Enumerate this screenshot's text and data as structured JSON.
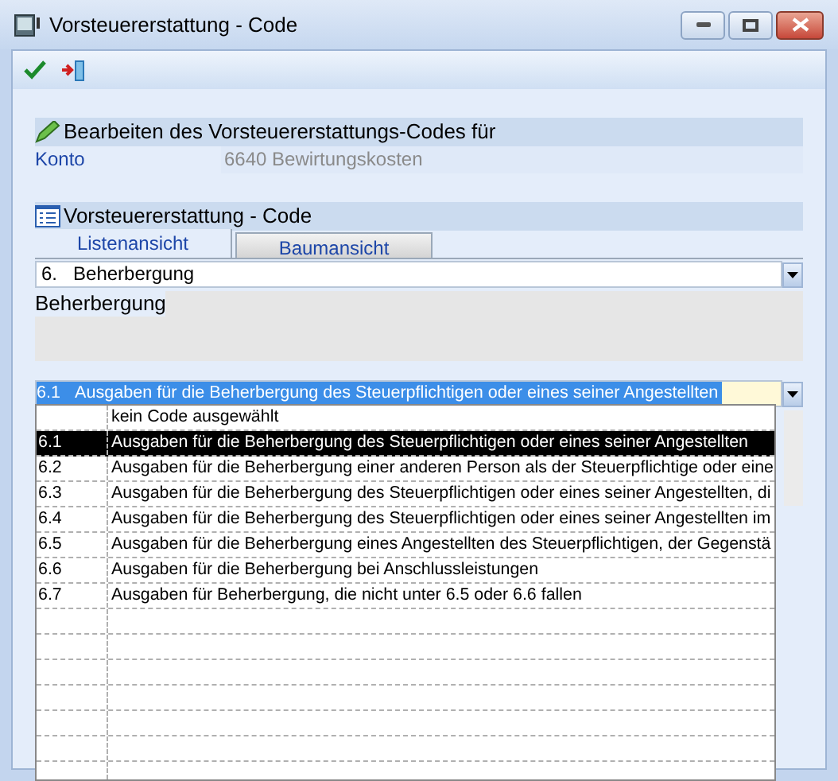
{
  "window": {
    "title": "Vorsteuererstattung - Code"
  },
  "edit_section": {
    "title": "Bearbeiten des Vorsteuererstattungs-Codes für",
    "konto_label": "Konto",
    "konto_value": "6640 Bewirtungskosten"
  },
  "code_section": {
    "title": "Vorsteuererstattung - Code"
  },
  "tabs": [
    {
      "label": "Listenansicht",
      "selected": true
    },
    {
      "label": "Baumansicht",
      "selected": false
    }
  ],
  "category_combo": {
    "value": "6.   Beherbergung"
  },
  "description": "Beherbergung",
  "code_combo": {
    "code": "6.1",
    "text": "Ausgaben für die Beherbergung des Steuerpflichtigen oder eines seiner Angestellten"
  },
  "dropdown_rows": [
    {
      "code": "",
      "text": "kein Code ausgewählt",
      "selected": false
    },
    {
      "code": "6.1",
      "text": "Ausgaben für die Beherbergung des Steuerpflichtigen oder eines seiner Angestellten",
      "selected": true
    },
    {
      "code": "6.2",
      "text": "Ausgaben für die Beherbergung einer anderen Person als der Steuerpflichtige oder eine",
      "selected": false
    },
    {
      "code": "6.3",
      "text": "Ausgaben für die Beherbergung des Steuerpflichtigen oder eines seiner Angestellten, di",
      "selected": false
    },
    {
      "code": "6.4",
      "text": "Ausgaben für die Beherbergung des Steuerpflichtigen oder eines seiner Angestellten im",
      "selected": false
    },
    {
      "code": "6.5",
      "text": "Ausgaben für die Beherbergung eines Angestellten des Steuerpflichtigen, der Gegenstä",
      "selected": false
    },
    {
      "code": "6.6",
      "text": "Ausgaben für die Beherbergung bei Anschlussleistungen",
      "selected": false
    },
    {
      "code": "6.7",
      "text": "Ausgaben für Beherbergung, die nicht unter 6.5 oder 6.6 fallen",
      "selected": false
    }
  ]
}
